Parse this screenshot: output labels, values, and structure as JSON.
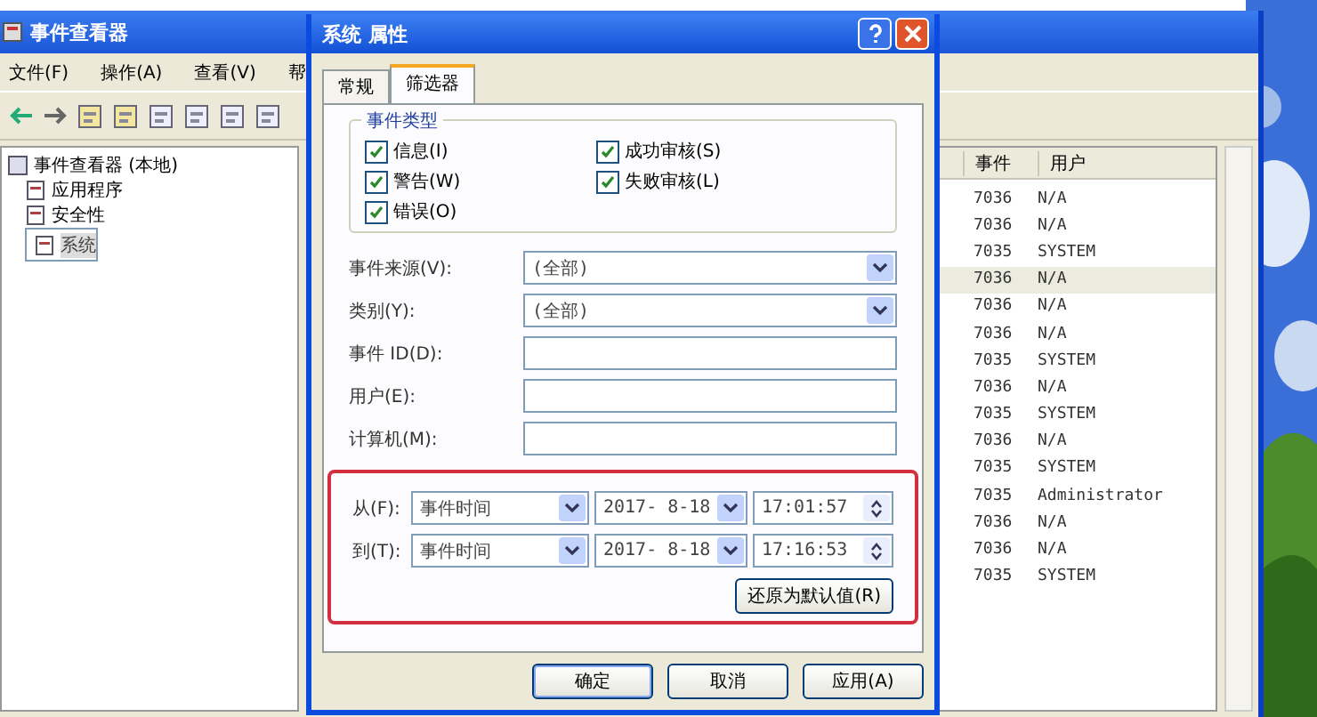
{
  "main_window": {
    "title": "事件查看器",
    "menu": [
      "文件(F)",
      "操作(A)",
      "查看(V)",
      "帮"
    ],
    "tree": [
      {
        "label": "事件查看器 (本地)",
        "selected": false,
        "children": [
          {
            "label": "应用程序",
            "selected": false
          },
          {
            "label": "安全性",
            "selected": false
          },
          {
            "label": "系统",
            "selected": true
          }
        ]
      }
    ],
    "list": {
      "columns": [
        "事件",
        "用户"
      ],
      "rows": [
        {
          "event": "7036",
          "user": "N/A",
          "selected": false
        },
        {
          "event": "7036",
          "user": "N/A",
          "selected": false
        },
        {
          "event": "7035",
          "user": "SYSTEM",
          "selected": false
        },
        {
          "event": "7036",
          "user": "N/A",
          "selected": true
        },
        {
          "event": "7036",
          "user": "N/A",
          "selected": false
        },
        {
          "event": "7036",
          "user": "N/A",
          "selected": false
        },
        {
          "event": "7035",
          "user": "SYSTEM",
          "selected": false
        },
        {
          "event": "7036",
          "user": "N/A",
          "selected": false
        },
        {
          "event": "7035",
          "user": "SYSTEM",
          "selected": false
        },
        {
          "event": "7036",
          "user": "N/A",
          "selected": false
        },
        {
          "event": "7035",
          "user": "SYSTEM",
          "selected": false
        },
        {
          "event": "7035",
          "user": "Administrator",
          "selected": false
        },
        {
          "event": "7036",
          "user": "N/A",
          "selected": false
        },
        {
          "event": "7036",
          "user": "N/A",
          "selected": false
        },
        {
          "event": "7035",
          "user": "SYSTEM",
          "selected": false
        }
      ]
    }
  },
  "dialog": {
    "title": "系统 属性",
    "tabs": [
      {
        "label": "常规",
        "selected": false
      },
      {
        "label": "筛选器",
        "selected": true
      }
    ],
    "event_types": {
      "title": "事件类型",
      "options": [
        {
          "label": "信息(I)",
          "checked": true
        },
        {
          "label": "成功审核(S)",
          "checked": true
        },
        {
          "label": "警告(W)",
          "checked": true
        },
        {
          "label": "失败审核(L)",
          "checked": true
        },
        {
          "label": "错误(O)",
          "checked": true
        }
      ]
    },
    "fields": [
      {
        "kind": "select",
        "label": "事件来源(V):",
        "value": "(全部)"
      },
      {
        "kind": "select",
        "label": "类别(Y):",
        "value": "(全部)"
      },
      {
        "kind": "text",
        "label": "事件 ID(D):"
      },
      {
        "kind": "text",
        "label": "用户(E):"
      },
      {
        "kind": "text",
        "label": "计算机(M):"
      }
    ],
    "range": [
      {
        "label": "从(F):",
        "mode": "事件时间",
        "date": "2017- 8-18",
        "time": "17:01:57"
      },
      {
        "label": "到(T):",
        "mode": "事件时间",
        "date": "2017- 8-18",
        "time": "17:16:53"
      }
    ],
    "restore_button": "还原为默认值(R)",
    "buttons": [
      "确定",
      "取消",
      "应用(A)"
    ]
  }
}
